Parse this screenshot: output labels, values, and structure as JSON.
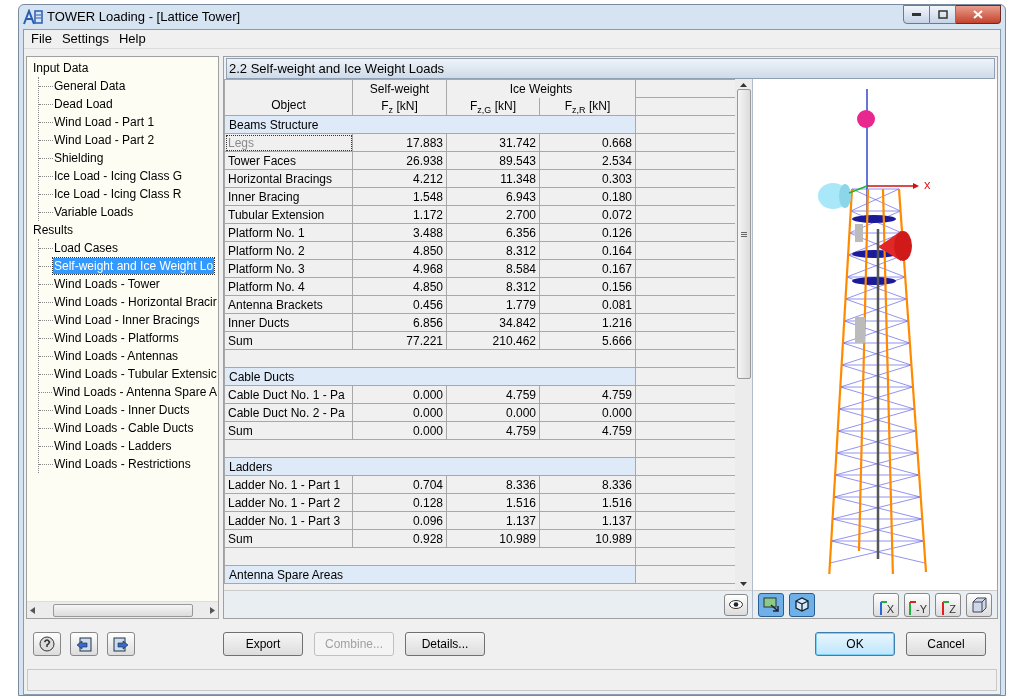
{
  "window": {
    "title": "TOWER Loading - [Lattice Tower]"
  },
  "menu": [
    "File",
    "Settings",
    "Help"
  ],
  "tree": [
    {
      "label": "Input Data",
      "children": [
        {
          "label": "General Data",
          "selected": false
        },
        {
          "label": "Dead Load",
          "selected": false
        },
        {
          "label": "Wind Load - Part 1",
          "selected": false
        },
        {
          "label": "Wind Load - Part 2",
          "selected": false
        },
        {
          "label": "Shielding",
          "selected": false
        },
        {
          "label": "Ice Load - Icing Class G",
          "selected": false
        },
        {
          "label": "Ice Load - Icing Class R",
          "selected": false
        },
        {
          "label": "Variable Loads",
          "selected": false
        }
      ]
    },
    {
      "label": "Results",
      "children": [
        {
          "label": "Load Cases",
          "selected": false
        },
        {
          "label": "Self-weight and Ice Weight Lo",
          "selected": true
        },
        {
          "label": "Wind Loads - Tower",
          "selected": false
        },
        {
          "label": "Wind Loads - Horizontal Bracir",
          "selected": false
        },
        {
          "label": "Wind Load - Inner Bracings",
          "selected": false
        },
        {
          "label": "Wind Loads - Platforms",
          "selected": false
        },
        {
          "label": "Wind Loads - Antennas",
          "selected": false
        },
        {
          "label": "Wind Loads - Tubular Extensic",
          "selected": false
        },
        {
          "label": "Wind Loads - Antenna Spare A",
          "selected": false
        },
        {
          "label": "Wind Loads - Inner Ducts",
          "selected": false
        },
        {
          "label": "Wind Loads - Cable Ducts",
          "selected": false
        },
        {
          "label": "Wind Loads - Ladders",
          "selected": false
        },
        {
          "label": "Wind Loads - Restrictions",
          "selected": false
        }
      ]
    }
  ],
  "panel_title": "2.2 Self-weight and Ice Weight Loads",
  "table": {
    "column_groups": [
      "Self-weight",
      "Ice Weights"
    ],
    "columns": [
      "Object",
      "F$_{z}$ [kN]",
      "F$_{z,G}$ [kN]",
      "F$_{z,R}$ [kN]"
    ],
    "rows": [
      {
        "kind": "group",
        "label": "Beams Structure"
      },
      {
        "kind": "data",
        "focused": true,
        "cells": [
          "Legs",
          "17.883",
          "31.742",
          "0.668"
        ]
      },
      {
        "kind": "data",
        "focused": false,
        "cells": [
          "Tower Faces",
          "26.938",
          "89.543",
          "2.534"
        ]
      },
      {
        "kind": "data",
        "focused": false,
        "cells": [
          "Horizontal Bracings",
          "4.212",
          "11.348",
          "0.303"
        ]
      },
      {
        "kind": "data",
        "focused": false,
        "cells": [
          "Inner Bracing",
          "1.548",
          "6.943",
          "0.180"
        ]
      },
      {
        "kind": "data",
        "focused": false,
        "cells": [
          "Tubular Extension",
          "1.172",
          "2.700",
          "0.072"
        ]
      },
      {
        "kind": "data",
        "focused": false,
        "cells": [
          "Platform No. 1",
          "3.488",
          "6.356",
          "0.126"
        ]
      },
      {
        "kind": "data",
        "focused": false,
        "cells": [
          "Platform No. 2",
          "4.850",
          "8.312",
          "0.164"
        ]
      },
      {
        "kind": "data",
        "focused": false,
        "cells": [
          "Platform No. 3",
          "4.968",
          "8.584",
          "0.167"
        ]
      },
      {
        "kind": "data",
        "focused": false,
        "cells": [
          "Platform No. 4",
          "4.850",
          "8.312",
          "0.156"
        ]
      },
      {
        "kind": "data",
        "focused": false,
        "cells": [
          "Antenna Brackets",
          "0.456",
          "1.779",
          "0.081"
        ]
      },
      {
        "kind": "data",
        "focused": false,
        "cells": [
          "Inner Ducts",
          "6.856",
          "34.842",
          "1.216"
        ]
      },
      {
        "kind": "data",
        "focused": false,
        "cells": [
          "Sum",
          "77.221",
          "210.462",
          "5.666"
        ]
      },
      {
        "kind": "blank"
      },
      {
        "kind": "group",
        "label": "Cable Ducts"
      },
      {
        "kind": "data",
        "focused": false,
        "cells": [
          "Cable Duct No. 1 - Pa",
          "0.000",
          "4.759",
          "4.759"
        ]
      },
      {
        "kind": "data",
        "focused": false,
        "cells": [
          "Cable Duct No. 2 - Pa",
          "0.000",
          "0.000",
          "0.000"
        ]
      },
      {
        "kind": "data",
        "focused": false,
        "cells": [
          "Sum",
          "0.000",
          "4.759",
          "4.759"
        ]
      },
      {
        "kind": "blank"
      },
      {
        "kind": "group",
        "label": "Ladders"
      },
      {
        "kind": "data",
        "focused": false,
        "cells": [
          "Ladder No. 1 - Part 1",
          "0.704",
          "8.336",
          "8.336"
        ]
      },
      {
        "kind": "data",
        "focused": false,
        "cells": [
          "Ladder No. 1 - Part 2",
          "0.128",
          "1.516",
          "1.516"
        ]
      },
      {
        "kind": "data",
        "focused": false,
        "cells": [
          "Ladder No. 1 - Part 3",
          "0.096",
          "1.137",
          "1.137"
        ]
      },
      {
        "kind": "data",
        "focused": false,
        "cells": [
          "Sum",
          "0.928",
          "10.989",
          "10.989"
        ]
      },
      {
        "kind": "blank"
      },
      {
        "kind": "group",
        "label": "Antenna Spare Areas"
      }
    ]
  },
  "view": {
    "axis_label": "x",
    "view_buttons": [
      "X",
      "-Y",
      "Z"
    ]
  },
  "buttons": [
    {
      "label": "Export",
      "disabled": false
    },
    {
      "label": "Combine...",
      "disabled": true
    },
    {
      "label": "Details...",
      "disabled": false
    }
  ],
  "dialog_buttons": [
    {
      "label": "OK",
      "default": true
    },
    {
      "label": "Cancel",
      "default": false
    }
  ]
}
